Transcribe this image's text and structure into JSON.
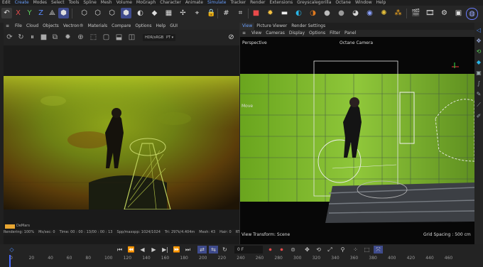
{
  "menubar": [
    "Edit",
    "Create",
    "Modes",
    "Select",
    "Tools",
    "Spline",
    "Mesh",
    "Volume",
    "MoGraph",
    "Character",
    "Animate",
    "Simulate",
    "Tracker",
    "Render",
    "Extensions",
    "Greyscalegorilla",
    "Octane",
    "Window",
    "Help"
  ],
  "menubar_active": [
    "Create",
    "Simulate"
  ],
  "left_panel": {
    "menu": [
      "File",
      "Cloud",
      "Objects",
      "Vectron®",
      "Materials",
      "Compare",
      "Options",
      "Help",
      "GUI"
    ],
    "color_space": "HDR/sRGB",
    "tone": "PT",
    "tag": "DeMars",
    "status": [
      "Rendering: 100%",
      "Ms/sec: 0",
      "Time: 00 : 00 : 13/00 : 00 : 13",
      "Spp/maxspp: 1024/1024",
      "Tri: 297k/4.404m",
      "Mesh: 43",
      "Hair: 0",
      "RTXon"
    ]
  },
  "viewport": {
    "tabs": [
      "View",
      "Picture Viewer",
      "Render Settings"
    ],
    "menu": [
      "View",
      "Cameras",
      "Display",
      "Options",
      "Filter",
      "Panel"
    ],
    "perspective": "Perspective",
    "camera": "Octane Camera",
    "move_label": "Move",
    "view_transform": "View Transform: Scene",
    "grid_spacing": "Grid Spacing : 500 cm"
  },
  "timeline": {
    "frame": "0 F",
    "ticks": [
      "0",
      "20",
      "40",
      "60",
      "80",
      "100",
      "120",
      "140",
      "160",
      "180",
      "200",
      "220",
      "240",
      "260",
      "280",
      "300",
      "320",
      "340",
      "360",
      "380",
      "400",
      "420",
      "440",
      "460"
    ]
  },
  "colors": {
    "accent": "#4a6cff",
    "active_menu": "#6aa0ff",
    "scene_green": "#7db32a"
  }
}
